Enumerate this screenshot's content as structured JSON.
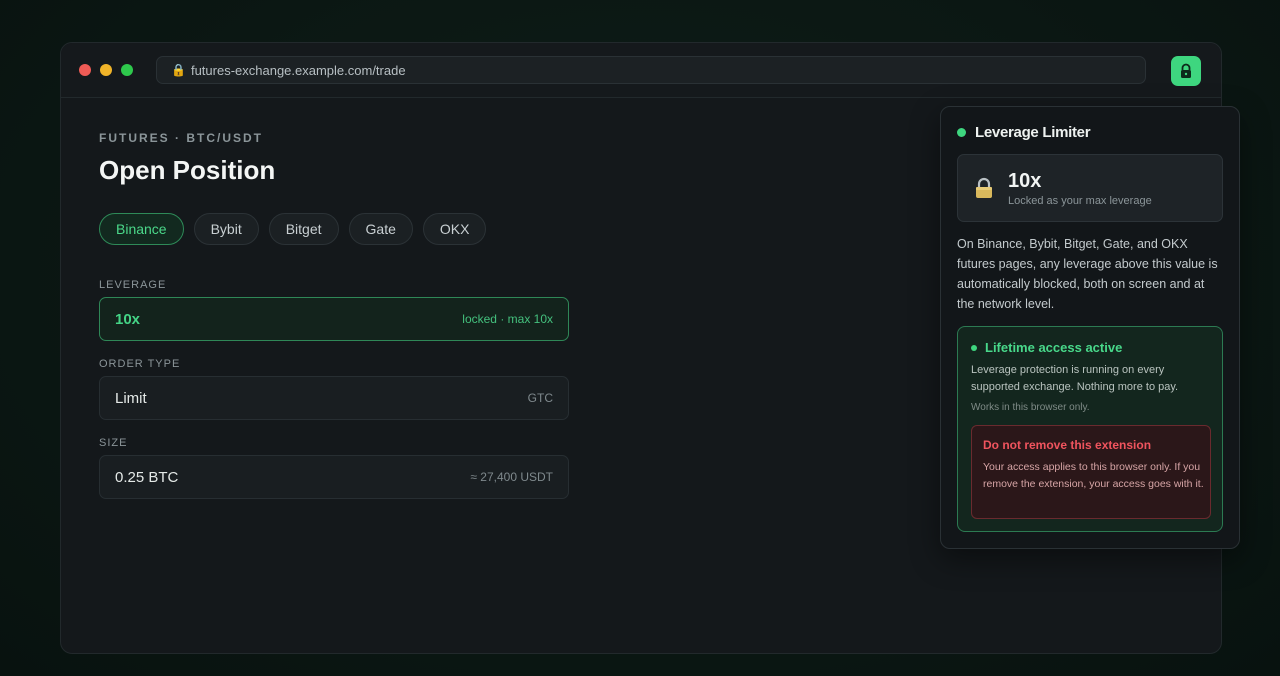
{
  "browser": {
    "url": "futures-exchange.example.com/trade"
  },
  "page": {
    "eyebrow": "FUTURES · BTC/USDT",
    "title": "Open Position",
    "exchanges": [
      "Binance",
      "Bybit",
      "Bitget",
      "Gate",
      "OKX"
    ],
    "active_exchange": "Binance"
  },
  "form": {
    "leverage": {
      "label": "LEVERAGE",
      "value": "10x",
      "hint": "locked · max 10x"
    },
    "order_type": {
      "label": "ORDER TYPE",
      "value": "Limit",
      "hint": "GTC"
    },
    "size": {
      "label": "SIZE",
      "value": "0.25 BTC",
      "hint": "≈ 27,400 USDT"
    }
  },
  "popup": {
    "title": "Leverage Limiter",
    "leverage_value": "10x",
    "leverage_sub": "Locked as your max leverage",
    "description": "On Binance, Bybit, Bitget, Gate, and OKX futures pages, any leverage above this value is automatically blocked, both on screen and at the network level.",
    "access": {
      "title": "Lifetime access active",
      "text": "Leverage protection is running on every supported exchange. Nothing more to pay.",
      "note": "Works in this browser only."
    },
    "warning": {
      "title": "Do not remove this extension",
      "text": "Your access applies to this browser only. If you remove the extension, your access goes with it."
    }
  },
  "colors": {
    "accent": "#3ed67f",
    "warning": "#f0545e",
    "background": "#14181b"
  }
}
